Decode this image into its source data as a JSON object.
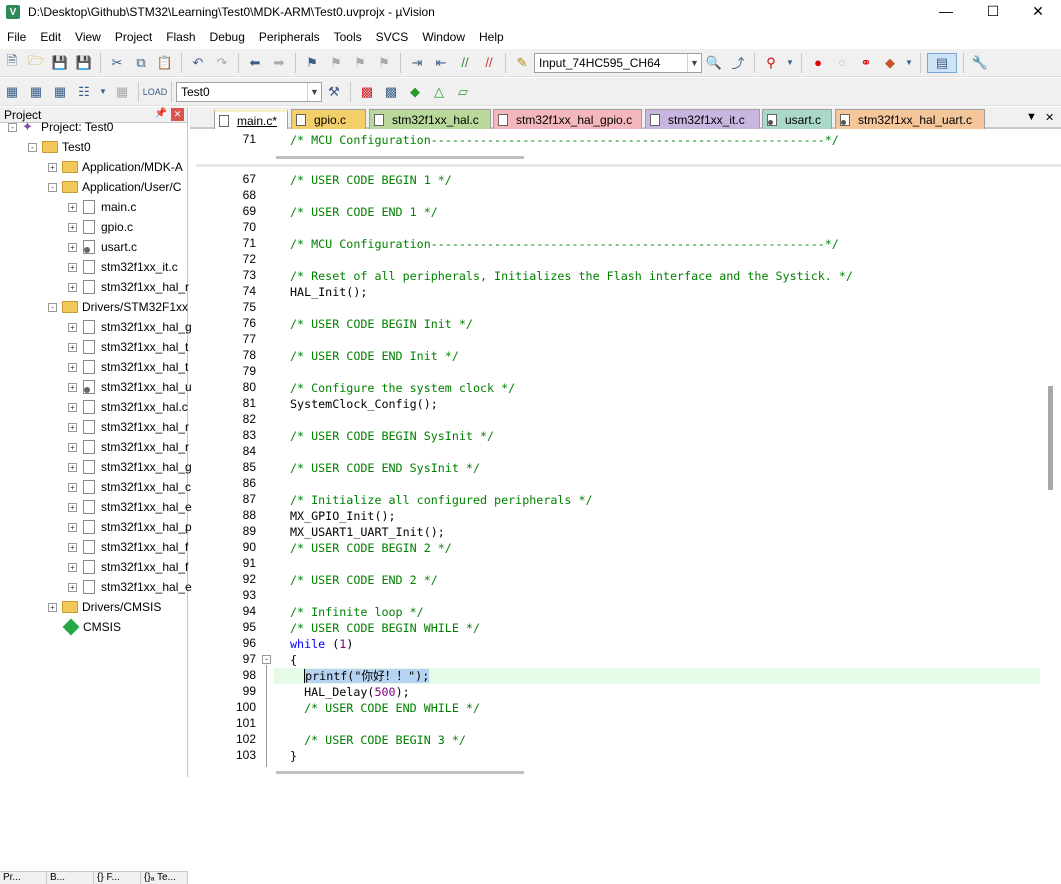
{
  "window": {
    "title": "D:\\Desktop\\Github\\STM32\\Learning\\Test0\\MDK-ARM\\Test0.uvprojx - µVision",
    "app_icon": "V"
  },
  "menu": [
    "File",
    "Edit",
    "View",
    "Project",
    "Flash",
    "Debug",
    "Peripherals",
    "Tools",
    "SVCS",
    "Window",
    "Help"
  ],
  "toolbar1": {
    "target_combo": "Input_74HC595_CH64"
  },
  "toolbar2": {
    "target_select": "Test0"
  },
  "project_panel": {
    "title": "Project",
    "tree": [
      {
        "label": "Project: Test0",
        "indent": 0,
        "icon": "project-icon",
        "exp": "-"
      },
      {
        "label": "Test0",
        "indent": 1,
        "icon": "folder-icon",
        "exp": "-"
      },
      {
        "label": "Application/MDK-A",
        "indent": 2,
        "icon": "folder-icon",
        "exp": "+"
      },
      {
        "label": "Application/User/C",
        "indent": 2,
        "icon": "folder-icon",
        "exp": "-"
      },
      {
        "label": "main.c",
        "indent": 3,
        "icon": "file-icon",
        "exp": "+"
      },
      {
        "label": "gpio.c",
        "indent": 3,
        "icon": "file-icon",
        "exp": "+"
      },
      {
        "label": "usart.c",
        "indent": 3,
        "icon": "file-gear-icon",
        "exp": "+"
      },
      {
        "label": "stm32f1xx_it.c",
        "indent": 3,
        "icon": "file-icon",
        "exp": "+"
      },
      {
        "label": "stm32f1xx_hal_r",
        "indent": 3,
        "icon": "file-icon",
        "exp": "+"
      },
      {
        "label": "Drivers/STM32F1xx",
        "indent": 2,
        "icon": "folder-icon",
        "exp": "-"
      },
      {
        "label": "stm32f1xx_hal_g",
        "indent": 3,
        "icon": "file-icon",
        "exp": "+"
      },
      {
        "label": "stm32f1xx_hal_t",
        "indent": 3,
        "icon": "file-icon",
        "exp": "+"
      },
      {
        "label": "stm32f1xx_hal_t",
        "indent": 3,
        "icon": "file-icon",
        "exp": "+"
      },
      {
        "label": "stm32f1xx_hal_u",
        "indent": 3,
        "icon": "file-gear-icon",
        "exp": "+"
      },
      {
        "label": "stm32f1xx_hal.c",
        "indent": 3,
        "icon": "file-icon",
        "exp": "+"
      },
      {
        "label": "stm32f1xx_hal_r",
        "indent": 3,
        "icon": "file-icon",
        "exp": "+"
      },
      {
        "label": "stm32f1xx_hal_r",
        "indent": 3,
        "icon": "file-icon",
        "exp": "+"
      },
      {
        "label": "stm32f1xx_hal_g",
        "indent": 3,
        "icon": "file-icon",
        "exp": "+"
      },
      {
        "label": "stm32f1xx_hal_c",
        "indent": 3,
        "icon": "file-icon",
        "exp": "+"
      },
      {
        "label": "stm32f1xx_hal_e",
        "indent": 3,
        "icon": "file-icon",
        "exp": "+"
      },
      {
        "label": "stm32f1xx_hal_p",
        "indent": 3,
        "icon": "file-icon",
        "exp": "+"
      },
      {
        "label": "stm32f1xx_hal_f",
        "indent": 3,
        "icon": "file-icon",
        "exp": "+"
      },
      {
        "label": "stm32f1xx_hal_f",
        "indent": 3,
        "icon": "file-icon",
        "exp": "+"
      },
      {
        "label": "stm32f1xx_hal_e",
        "indent": 3,
        "icon": "file-icon",
        "exp": "+"
      },
      {
        "label": "Drivers/CMSIS",
        "indent": 2,
        "icon": "folder-icon",
        "exp": "+"
      },
      {
        "label": "CMSIS",
        "indent": 2,
        "icon": "cmsis-icon",
        "exp": ""
      }
    ],
    "bottom_tabs": [
      "Pr...",
      "B...",
      "{} F...",
      "{}ₐ Te..."
    ]
  },
  "file_tabs": [
    {
      "label": "main.c*",
      "color": "#f7f1c9",
      "active": true,
      "icon": "file"
    },
    {
      "label": "gpio.c",
      "color": "#f2cf6a",
      "active": false,
      "icon": "file"
    },
    {
      "label": "stm32f1xx_hal.c",
      "color": "#b9d99a",
      "active": false,
      "icon": "file"
    },
    {
      "label": "stm32f1xx_hal_gpio.c",
      "color": "#f4b7bd",
      "active": false,
      "icon": "file"
    },
    {
      "label": "stm32f1xx_it.c",
      "color": "#c9b6e0",
      "active": false,
      "icon": "file"
    },
    {
      "label": "usart.c",
      "color": "#a9d8c9",
      "active": false,
      "icon": "gear"
    },
    {
      "label": "stm32f1xx_hal_uart.c",
      "color": "#f5c69a",
      "active": false,
      "icon": "gear"
    }
  ],
  "split_view": {
    "line": "71",
    "code": "/* MCU Configuration--------------------------------------------------------*/"
  },
  "code_lines": [
    {
      "n": "67",
      "t": "/* USER CODE BEGIN 1 */",
      "c": "cmt"
    },
    {
      "n": "68",
      "t": "",
      "c": ""
    },
    {
      "n": "69",
      "t": "/* USER CODE END 1 */",
      "c": "cmt"
    },
    {
      "n": "70",
      "t": "",
      "c": ""
    },
    {
      "n": "71",
      "t": "/* MCU Configuration--------------------------------------------------------*/",
      "c": "cmt"
    },
    {
      "n": "72",
      "t": "",
      "c": ""
    },
    {
      "n": "73",
      "t": "/* Reset of all peripherals, Initializes the Flash interface and the Systick. */",
      "c": "cmt"
    },
    {
      "n": "74",
      "t": "HAL_Init();",
      "c": ""
    },
    {
      "n": "75",
      "t": "",
      "c": ""
    },
    {
      "n": "76",
      "t": "/* USER CODE BEGIN Init */",
      "c": "cmt"
    },
    {
      "n": "77",
      "t": "",
      "c": ""
    },
    {
      "n": "78",
      "t": "/* USER CODE END Init */",
      "c": "cmt"
    },
    {
      "n": "79",
      "t": "",
      "c": ""
    },
    {
      "n": "80",
      "t": "/* Configure the system clock */",
      "c": "cmt"
    },
    {
      "n": "81",
      "t": "SystemClock_Config();",
      "c": ""
    },
    {
      "n": "82",
      "t": "",
      "c": ""
    },
    {
      "n": "83",
      "t": "/* USER CODE BEGIN SysInit */",
      "c": "cmt"
    },
    {
      "n": "84",
      "t": "",
      "c": ""
    },
    {
      "n": "85",
      "t": "/* USER CODE END SysInit */",
      "c": "cmt"
    },
    {
      "n": "86",
      "t": "",
      "c": ""
    },
    {
      "n": "87",
      "t": "/* Initialize all configured peripherals */",
      "c": "cmt"
    },
    {
      "n": "88",
      "t": "MX_GPIO_Init();",
      "c": ""
    },
    {
      "n": "89",
      "t": "MX_USART1_UART_Init();",
      "c": ""
    },
    {
      "n": "90",
      "t": "/* USER CODE BEGIN 2 */",
      "c": "cmt"
    },
    {
      "n": "91",
      "t": "",
      "c": ""
    },
    {
      "n": "92",
      "t": "/* USER CODE END 2 */",
      "c": "cmt"
    },
    {
      "n": "93",
      "t": "",
      "c": ""
    },
    {
      "n": "94",
      "t": "/* Infinite loop */",
      "c": "cmt"
    },
    {
      "n": "95",
      "t": "/* USER CODE BEGIN WHILE */",
      "c": "cmt"
    },
    {
      "n": "96",
      "t": "while (1)",
      "c": "while"
    },
    {
      "n": "97",
      "t": "{",
      "c": ""
    },
    {
      "n": "98",
      "t": "  printf(\"你好！！\");",
      "c": "sel"
    },
    {
      "n": "99",
      "t": "  HAL_Delay(500);",
      "c": "delay"
    },
    {
      "n": "100",
      "t": "  /* USER CODE END WHILE */",
      "c": "cmt"
    },
    {
      "n": "101",
      "t": "",
      "c": ""
    },
    {
      "n": "102",
      "t": "  /* USER CODE BEGIN 3 */",
      "c": "cmt"
    },
    {
      "n": "103",
      "t": "}",
      "c": ""
    }
  ]
}
